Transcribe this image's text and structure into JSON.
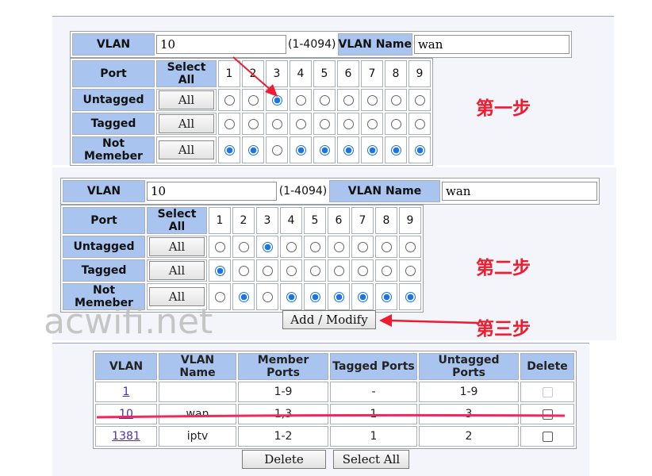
{
  "form1": {
    "vlan_label": "VLAN",
    "vlan_value": "10",
    "vlan_range": "(1-4094)",
    "vlan_name_label": "VLAN Name",
    "vlan_name_value": "wan",
    "port_label": "Port",
    "select_all_label": "Select All",
    "ports": [
      "1",
      "2",
      "3",
      "4",
      "5",
      "6",
      "7",
      "8",
      "9"
    ],
    "rows": [
      {
        "label": "Untagged",
        "all": "All",
        "selected": [
          3
        ]
      },
      {
        "label": "Tagged",
        "all": "All",
        "selected": []
      },
      {
        "label": "Not Memeber",
        "all": "All",
        "selected": [
          1,
          2,
          4,
          5,
          6,
          7,
          8,
          9
        ]
      }
    ]
  },
  "form2": {
    "vlan_label": "VLAN",
    "vlan_value": "10",
    "vlan_range": "(1-4094)",
    "vlan_name_label": "VLAN Name",
    "vlan_name_value": "wan",
    "port_label": "Port",
    "select_all_label": "Select All",
    "ports": [
      "1",
      "2",
      "3",
      "4",
      "5",
      "6",
      "7",
      "8",
      "9"
    ],
    "rows": [
      {
        "label": "Untagged",
        "all": "All",
        "selected": [
          3
        ]
      },
      {
        "label": "Tagged",
        "all": "All",
        "selected": [
          1
        ]
      },
      {
        "label": "Not Memeber",
        "all": "All",
        "selected": [
          2,
          4,
          5,
          6,
          7,
          8,
          9
        ]
      }
    ]
  },
  "add_modify_label": "Add / Modify",
  "annotations": {
    "step1": "第一步",
    "step2": "第二步",
    "step3": "第三步"
  },
  "watermark": "acwifi.net",
  "vlan_table": {
    "headers": [
      "VLAN",
      "VLAN Name",
      "Member Ports",
      "Tagged Ports",
      "Untagged Ports",
      "Delete"
    ],
    "rows": [
      {
        "vlan": "1",
        "name": "",
        "member": "1-9",
        "tagged": "-",
        "untagged": "1-9",
        "delete_enabled": false
      },
      {
        "vlan": "10",
        "name": "wan",
        "member": "1,3",
        "tagged": "1",
        "untagged": "3",
        "delete_enabled": true
      },
      {
        "vlan": "1381",
        "name": "iptv",
        "member": "1-2",
        "tagged": "1",
        "untagged": "2",
        "delete_enabled": true
      }
    ]
  },
  "delete_button": "Delete",
  "select_all_button": "Select All",
  "colors": {
    "header_bg": "#a9c4ef",
    "annotation": "#ee1c2e",
    "radio_on": "#1a73e8"
  }
}
